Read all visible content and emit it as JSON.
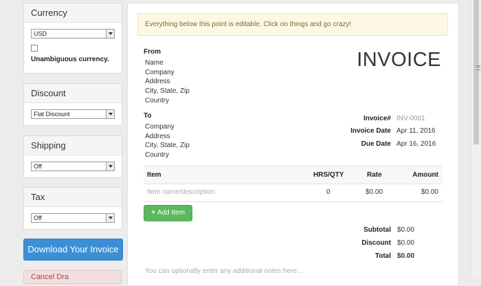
{
  "sidebar": {
    "currency": {
      "title": "Currency",
      "selected": "USD",
      "unambiguous_label": "Unambiguous currency."
    },
    "discount": {
      "title": "Discount",
      "selected": "Flat Discount"
    },
    "shipping": {
      "title": "Shipping",
      "selected": "Off"
    },
    "tax": {
      "title": "Tax",
      "selected": "Off"
    },
    "download_label": "Download Your Invoice",
    "cancel_label": "Cancel Dra"
  },
  "invoice": {
    "notice": "Everything below this point is editable. Click on things and go crazy!",
    "title": "INVOICE",
    "from": {
      "label": "From",
      "lines": [
        "Name",
        "Company",
        "Address",
        "City, State, Zip",
        "Country"
      ]
    },
    "to": {
      "label": "To",
      "lines": [
        "Company",
        "Address",
        "City, State, Zip",
        "Country"
      ]
    },
    "meta": {
      "invoice_no_label": "Invoice#",
      "invoice_no_value": "INV-0001",
      "invoice_date_label": "Invoice Date",
      "invoice_date_value": "Apr 11, 2016",
      "due_date_label": "Due Date",
      "due_date_value": "Apr 16, 2016"
    },
    "table": {
      "headers": {
        "item": "Item",
        "qty": "HRS/QTY",
        "rate": "Rate",
        "amount": "Amount"
      },
      "rows": [
        {
          "item": "Item name/description",
          "qty": "0",
          "rate": "$0.00",
          "amount": "$0.00"
        }
      ]
    },
    "add_item_label": "Add Item",
    "totals": {
      "subtotal_label": "Subtotal",
      "subtotal_value": "$0.00",
      "discount_label": "Discount",
      "discount_value": "$0.00",
      "total_label": "Total",
      "total_value": "$0.00"
    },
    "notes_placeholder": "You can optionally enter any additional notes here..."
  },
  "colors": {
    "primary_button": "#3c8fd6",
    "success_button": "#5cb85c",
    "notice_bg": "#fcf8e3",
    "danger_bg": "#f2dede"
  }
}
